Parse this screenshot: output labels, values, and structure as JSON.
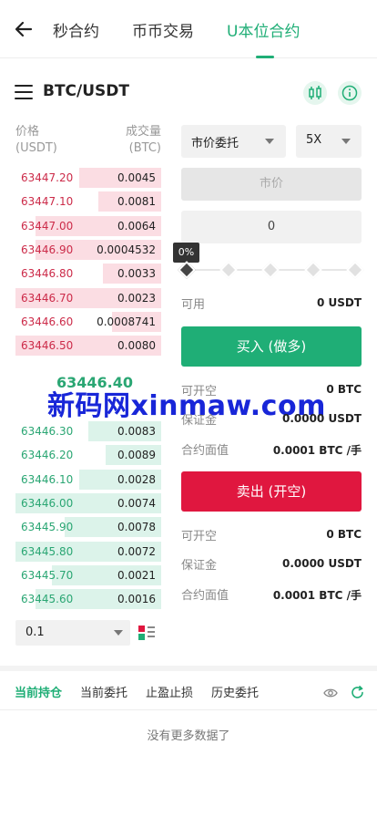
{
  "topbar": {
    "tabs": [
      {
        "label": "秒合约"
      },
      {
        "label": "币币交易"
      },
      {
        "label": "U本位合约"
      }
    ],
    "active_color": "#1fae76"
  },
  "pair": {
    "symbol": "BTC/USDT"
  },
  "orderbook": {
    "price_header": [
      "价格",
      "(USDT)"
    ],
    "volume_header": [
      "成交量",
      "(BTC)"
    ],
    "asks": [
      {
        "price": "63447.20",
        "qty": "0.0045",
        "depth": 0.56
      },
      {
        "price": "63447.10",
        "qty": "0.0081",
        "depth": 0.43
      },
      {
        "price": "63447.00",
        "qty": "0.0064",
        "depth": 0.86
      },
      {
        "price": "63446.90",
        "qty": "0.0004532",
        "depth": 0.86
      },
      {
        "price": "63446.80",
        "qty": "0.0033",
        "depth": 0.4
      },
      {
        "price": "63446.70",
        "qty": "0.0023",
        "depth": 1.0
      },
      {
        "price": "63446.60",
        "qty": "0.0008741",
        "depth": 0.34
      },
      {
        "price": "63446.50",
        "qty": "0.0080",
        "depth": 1.0
      }
    ],
    "mid_price": "63446.40",
    "bids": [
      {
        "price": "63446.30",
        "qty": "0.0083",
        "depth": 0.5
      },
      {
        "price": "63446.20",
        "qty": "0.0089",
        "depth": 0.38
      },
      {
        "price": "63446.10",
        "qty": "0.0028",
        "depth": 0.56
      },
      {
        "price": "63446.00",
        "qty": "0.0074",
        "depth": 1.0
      },
      {
        "price": "63445.90",
        "qty": "0.0078",
        "depth": 0.66
      },
      {
        "price": "63445.80",
        "qty": "0.0072",
        "depth": 1.0
      },
      {
        "price": "63445.70",
        "qty": "0.0021",
        "depth": 0.75
      },
      {
        "price": "63445.60",
        "qty": "0.0016",
        "depth": 0.86
      }
    ],
    "amount_select": "0.1"
  },
  "watermark": "新码网xinmaw.com",
  "order_form": {
    "order_type": "市价委托",
    "leverage": "5X",
    "price_placeholder": "市价",
    "quantity_value": "0",
    "percent": "0%",
    "percent_value": 0,
    "available_label": "可用",
    "available_value": "0 USDT",
    "buy_label": "买入 (做多)",
    "sell_label": "卖出 (开空)",
    "buy_info": [
      {
        "label": "可开空",
        "value": "0 BTC"
      },
      {
        "label": "保证金",
        "value": "0.0000 USDT"
      },
      {
        "label": "合约面值",
        "value": "0.0001 BTC /手"
      }
    ],
    "sell_info": [
      {
        "label": "可开空",
        "value": "0 BTC"
      },
      {
        "label": "保证金",
        "value": "0.0000 USDT"
      },
      {
        "label": "合约面值",
        "value": "0.0001 BTC /手"
      }
    ],
    "buy_color": "#1fae76",
    "sell_color": "#e0173f"
  },
  "bottom_tabs": [
    {
      "label": "当前持仓"
    },
    {
      "label": "当前委托"
    },
    {
      "label": "止盈止损"
    },
    {
      "label": "历史委托"
    }
  ],
  "empty_text": "没有更多数据了"
}
